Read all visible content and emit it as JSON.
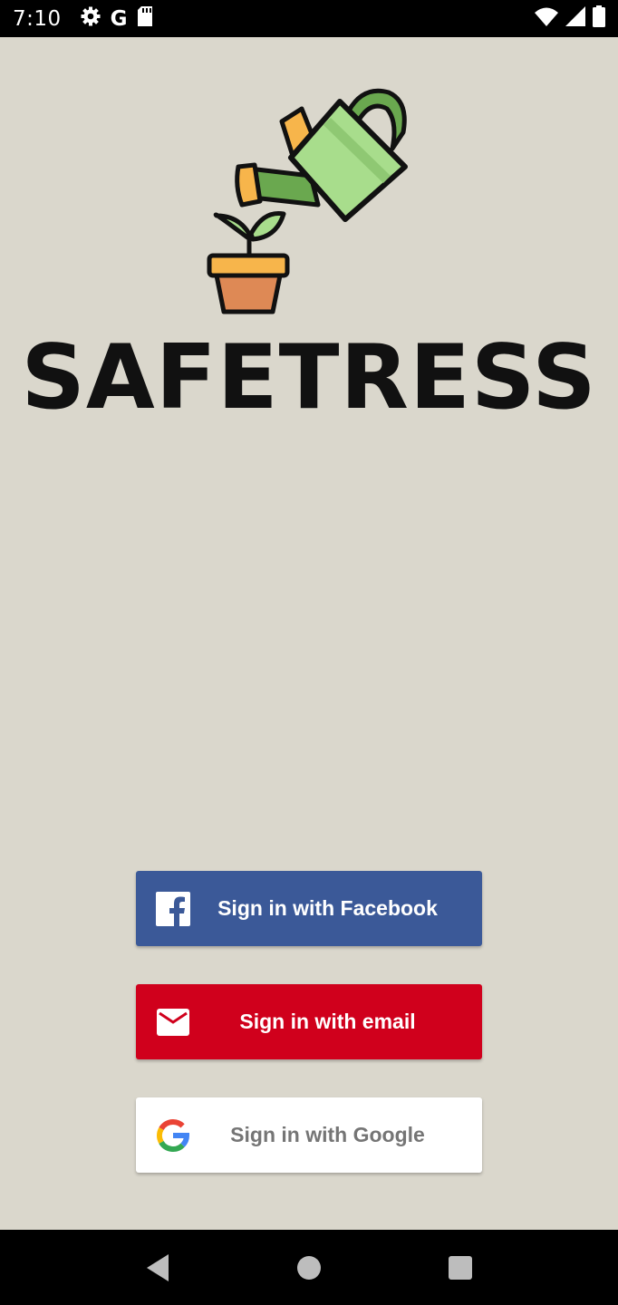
{
  "status_bar": {
    "time": "7:10",
    "left_icons": [
      "gear-icon",
      "google-g-icon",
      "sd-card-icon"
    ],
    "right_icons": [
      "wifi-icon",
      "cell-signal-icon",
      "battery-icon"
    ],
    "google_glyph": "G"
  },
  "brand": {
    "name": "SAFETRESS",
    "logo": "watering-can-plant-logo"
  },
  "buttons": {
    "facebook": {
      "label": "Sign in with Facebook",
      "icon": "facebook-icon",
      "color": "#3b5998"
    },
    "email": {
      "label": "Sign in with email",
      "icon": "mail-icon",
      "color": "#d0001c"
    },
    "google": {
      "label": "Sign in with Google",
      "icon": "google-icon",
      "color": "#ffffff"
    }
  },
  "nav_bar": {
    "buttons": [
      "back-icon",
      "home-icon",
      "recents-icon"
    ]
  },
  "colors": {
    "background": "#dad7cc",
    "bars": "#000000"
  }
}
